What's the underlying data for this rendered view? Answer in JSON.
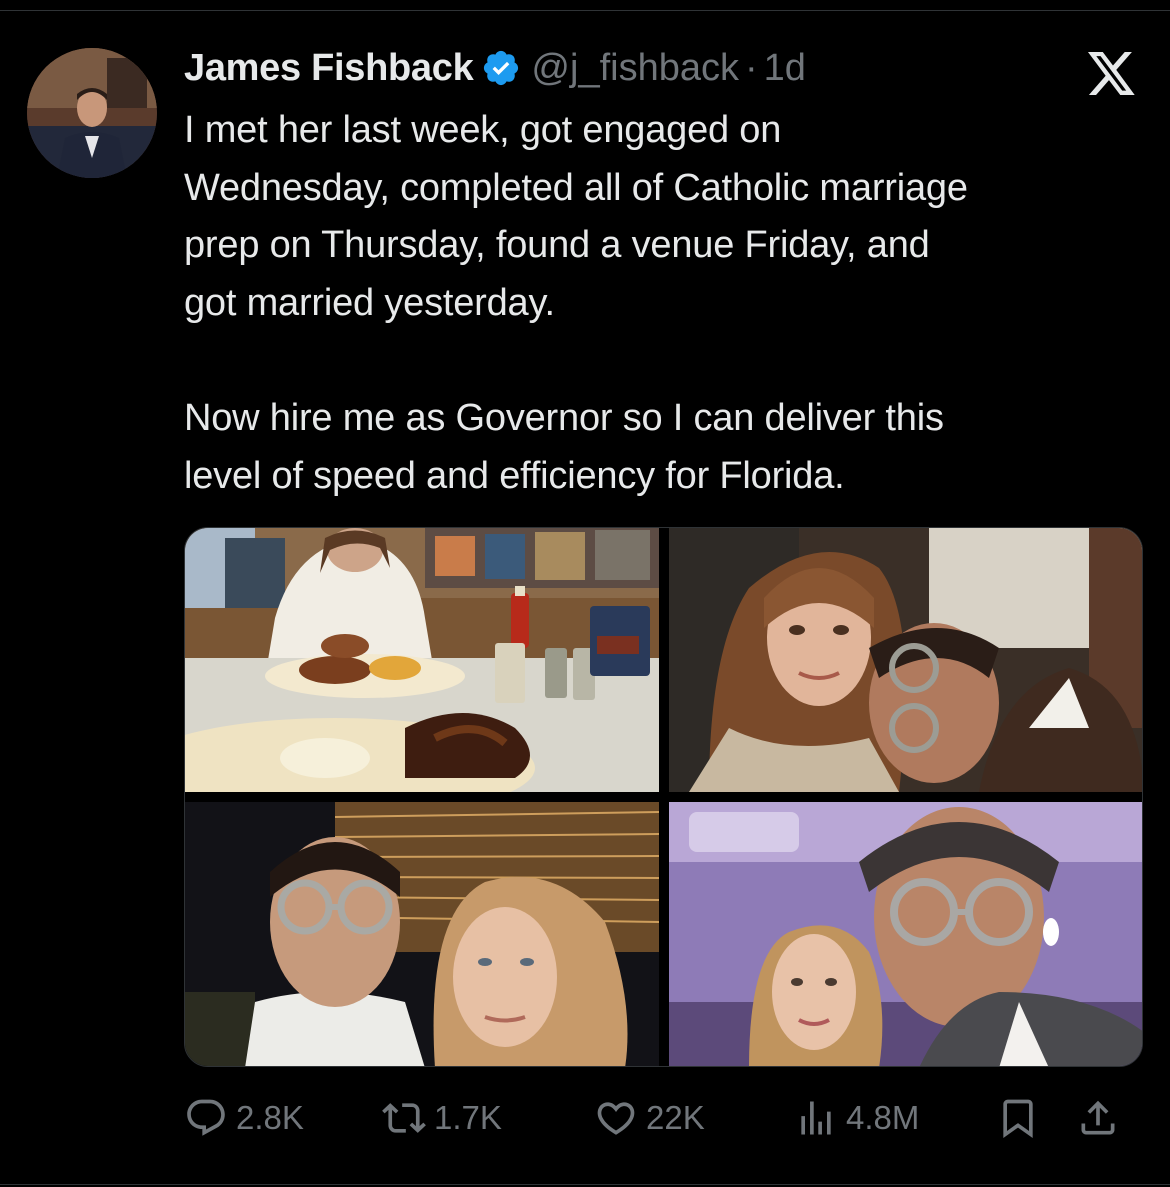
{
  "tweet": {
    "author_name": "James Fishback",
    "handle": "@j_fishback",
    "separator": "·",
    "time": "1d",
    "text": "I met her last week, got engaged on\nWednesday, completed all of Catholic marriage\nprep on Thursday, found a venue Friday, and\ngot married yesterday.\n\nNow hire me as Governor so I can deliver this\nlevel of speed and efficiency for Florida."
  },
  "icons": {
    "verified": "verified-badge-icon",
    "brand": "x-logo-icon",
    "reply": "reply-icon",
    "retweet": "retweet-icon",
    "like": "heart-icon",
    "views": "views-icon",
    "bookmark": "bookmark-icon",
    "share": "share-icon"
  },
  "media": {
    "count": 4
  },
  "stats": {
    "replies": "2.8K",
    "retweets": "1.7K",
    "likes": "22K",
    "views": "4.8M"
  },
  "colors": {
    "background": "#000000",
    "text": "#e7e9ea",
    "secondary": "#71767b",
    "verified": "#1d9bf0",
    "divider": "#2f3336"
  }
}
